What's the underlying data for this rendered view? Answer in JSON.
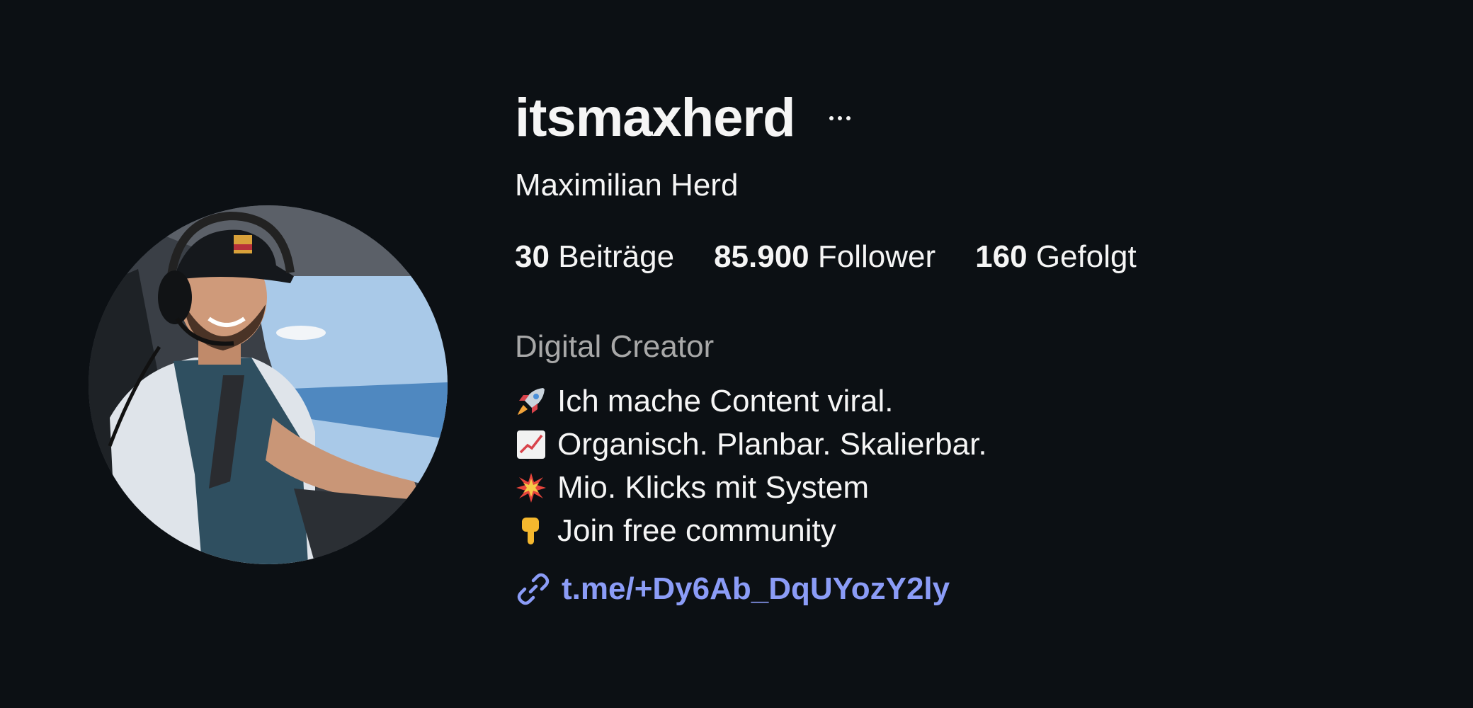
{
  "profile": {
    "username": "itsmaxherd",
    "more_icon": "more-horizontal-icon",
    "full_name": "Maximilian Herd",
    "avatar_icon": "profile-photo-pilot"
  },
  "stats": {
    "posts_count": "30",
    "posts_label": "Beiträge",
    "followers_count": "85.900",
    "followers_label": "Follower",
    "following_count": "160",
    "following_label": "Gefolgt"
  },
  "category": "Digital Creator",
  "bio": [
    {
      "emoji": "rocket-icon",
      "text": "Ich mache Content viral."
    },
    {
      "emoji": "chart-increasing-icon",
      "text": "Organisch. Planbar. Skalierbar."
    },
    {
      "emoji": "collision-icon",
      "text": "Mio. Klicks mit System"
    },
    {
      "emoji": "pointing-down-icon",
      "text": "Join free community"
    }
  ],
  "link": {
    "icon": "link-icon",
    "text": "t.me/+Dy6Ab_DqUYozY2ly"
  },
  "colors": {
    "background": "#0c1014",
    "text": "#f5f5f5",
    "secondary_text": "#a8a8a8",
    "link": "#8b9cf7"
  }
}
